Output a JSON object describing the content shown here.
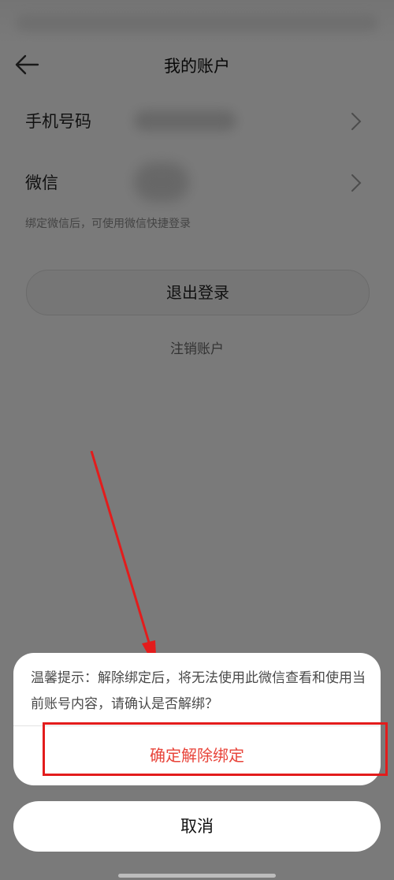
{
  "header": {
    "title": "我的账户"
  },
  "account": {
    "phone_label": "手机号码",
    "wechat_label": "微信",
    "wechat_hint": "绑定微信后，可使用微信快捷登录",
    "logout_label": "退出登录",
    "cancel_account_label": "注销账户"
  },
  "dialog": {
    "message": "温馨提示：解除绑定后，将无法使用此微信查看和使用当前账号内容，请确认是否解绑？",
    "confirm_label": "确定解除绑定",
    "cancel_label": "取消"
  },
  "icons": {
    "back": "back-arrow-icon",
    "chevron": "chevron-right-icon"
  },
  "colors": {
    "confirm": "#e8443a",
    "annotation": "#e31c1c"
  }
}
